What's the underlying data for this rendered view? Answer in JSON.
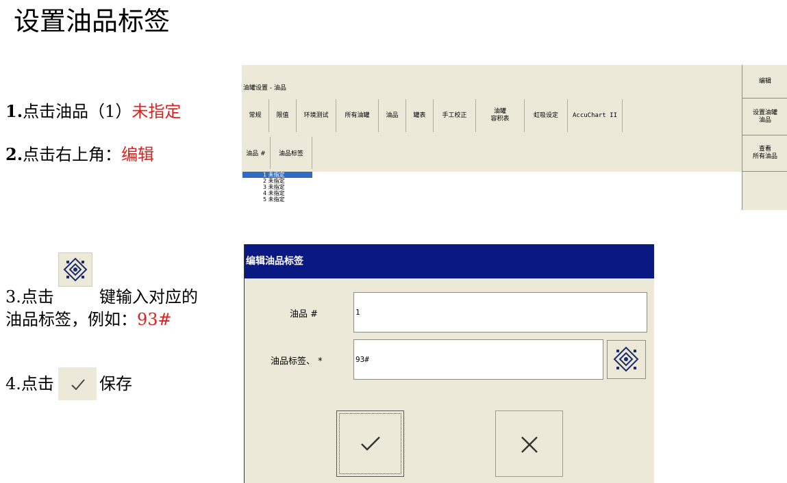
{
  "page_title": "设置油品标签",
  "steps": {
    "s1": {
      "num": "1.",
      "text": "点击油品（1）",
      "highlight": "未指定"
    },
    "s2": {
      "num": "2.",
      "text": "点击右上角：",
      "highlight": "编辑"
    },
    "s3": {
      "line1_pre": "3.点击",
      "line1_post": "键输入对应的",
      "line2_pre": "油品标签，例如：",
      "line2_highlight": "93#"
    },
    "s4": {
      "pre": "4.点击",
      "post": "保存"
    }
  },
  "panel": {
    "title": "油罐设置 - 油品",
    "tabs": [
      "常规",
      "限值",
      "环境测试",
      "所有油罐",
      "油品",
      "罐表",
      "手工校正",
      "油罐\n容积表",
      "虹吸设定",
      "AccuChart II"
    ],
    "columns": [
      "油品 #",
      "油品标签"
    ],
    "rows": [
      {
        "num": "1",
        "label": "未指定"
      },
      {
        "num": "2",
        "label": "未指定"
      },
      {
        "num": "3",
        "label": "未指定"
      },
      {
        "num": "4",
        "label": "未指定"
      },
      {
        "num": "5",
        "label": "未指定"
      }
    ],
    "side_buttons": [
      "编辑",
      "设置油罐\n油品",
      "查看\n所有油品"
    ]
  },
  "dialog": {
    "title": "编辑油品标签",
    "product_num_label": "油品 #",
    "product_num_value": "1",
    "product_label_label": "油品标签、 *",
    "product_label_value": "93#"
  },
  "icons": {
    "keyboard": "keyboard-icon",
    "check": "checkmark-icon",
    "close": "close-x-icon"
  },
  "colors": {
    "highlight": "#e0201c",
    "dialog_title_bg": "#0a1882",
    "selection": "#316ac5",
    "panel_bg": "#ece9d8"
  }
}
